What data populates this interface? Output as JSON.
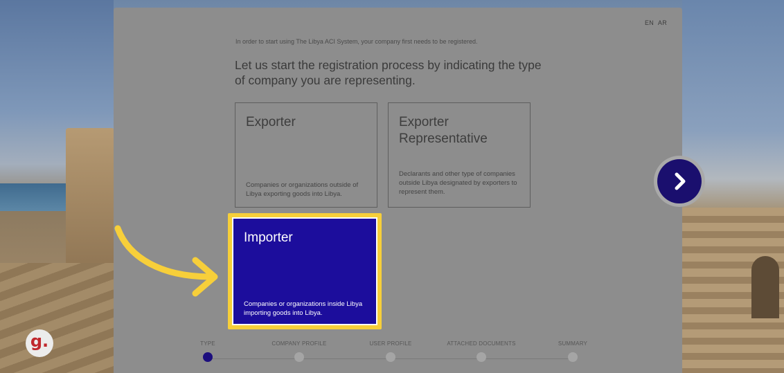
{
  "lang": {
    "en": "EN",
    "ar": "AR"
  },
  "intro_text": "In order to start using The Libya ACI System, your company first needs to be registered.",
  "headline": "Let us start the registration process by indicating the type of company you are representing.",
  "cards": {
    "exporter": {
      "title": "Exporter",
      "description": "Companies or organizations outside of Libya exporting goods into Libya."
    },
    "exporter_representative": {
      "title": "Exporter Representative",
      "description": "Declarants and other type of companies outside Libya designated by exporters to represent them."
    },
    "importer": {
      "title": "Importer",
      "description": "Companies or organizations inside Libya importing goods into Libya.",
      "selected": true
    }
  },
  "steps": [
    {
      "label": "TYPE",
      "active": true
    },
    {
      "label": "COMPANY PROFILE",
      "active": false
    },
    {
      "label": "USER PROFILE",
      "active": false
    },
    {
      "label": "ATTACHED DOCUMENTS",
      "active": false
    },
    {
      "label": "SUMMARY",
      "active": false
    }
  ],
  "next_button": {
    "icon": "chevron-right-icon"
  },
  "logo": {
    "text": "g.",
    "color": "#c0272d"
  },
  "colors": {
    "importer_bg": "#1c0d9c",
    "highlight": "#f7cf3a",
    "active_step": "#1c0e7e"
  }
}
